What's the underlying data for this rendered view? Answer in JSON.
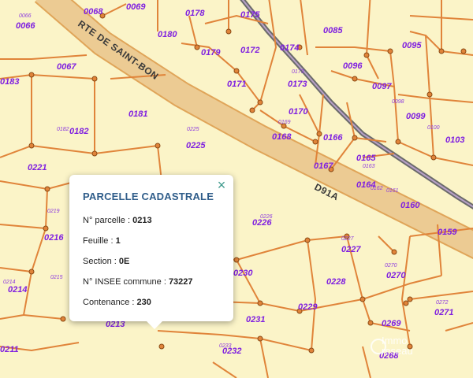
{
  "map": {
    "road_names": {
      "rte_saint_bon": "RTE DE SAINT-BON",
      "d91a": "D91A"
    },
    "parcels": [
      "0068",
      "0069",
      "0178",
      "0175",
      "0066",
      "0066",
      "0180",
      "0085",
      "0095",
      "0172",
      "0174",
      "0179",
      "0067",
      "0096",
      "0183",
      "0171",
      "0173",
      "0097",
      "0181",
      "0170",
      "0099",
      "0182",
      "0182",
      "0225",
      "0168",
      "0166",
      "0103",
      "0221",
      "0167",
      "0165",
      "0164",
      "0160",
      "0226",
      "0159",
      "0216",
      "0227",
      "0214",
      "0230",
      "0228",
      "0270",
      "0213",
      "0229",
      "0231",
      "0271",
      "0269",
      "0232",
      "0268",
      "0211"
    ],
    "small_labels": [
      "0066",
      "0175",
      "0173",
      "0098",
      "0100",
      "0169",
      "0163",
      "0162",
      "0161",
      "0233",
      "0219",
      "0215",
      "0214",
      "0226",
      "0227",
      "0270",
      "0272",
      "0225"
    ],
    "colors": {
      "background": "#fbf4c8",
      "parcel_line": "#e0843a",
      "road": "#e8c78a",
      "label": "#7f1fe0"
    }
  },
  "popup": {
    "title": "PARCELLE CADASTRALE",
    "close_icon": "×",
    "fields": [
      {
        "label": "N° parcelle : ",
        "value": "0213"
      },
      {
        "label": "Feuille : ",
        "value": "1"
      },
      {
        "label": "Section : ",
        "value": "0E"
      },
      {
        "label": "N° INSEE commune : ",
        "value": "73227"
      },
      {
        "label": "Contenance : ",
        "value": "230"
      }
    ]
  },
  "watermark": {
    "line1": "Immo",
    "line2": "reseau"
  }
}
